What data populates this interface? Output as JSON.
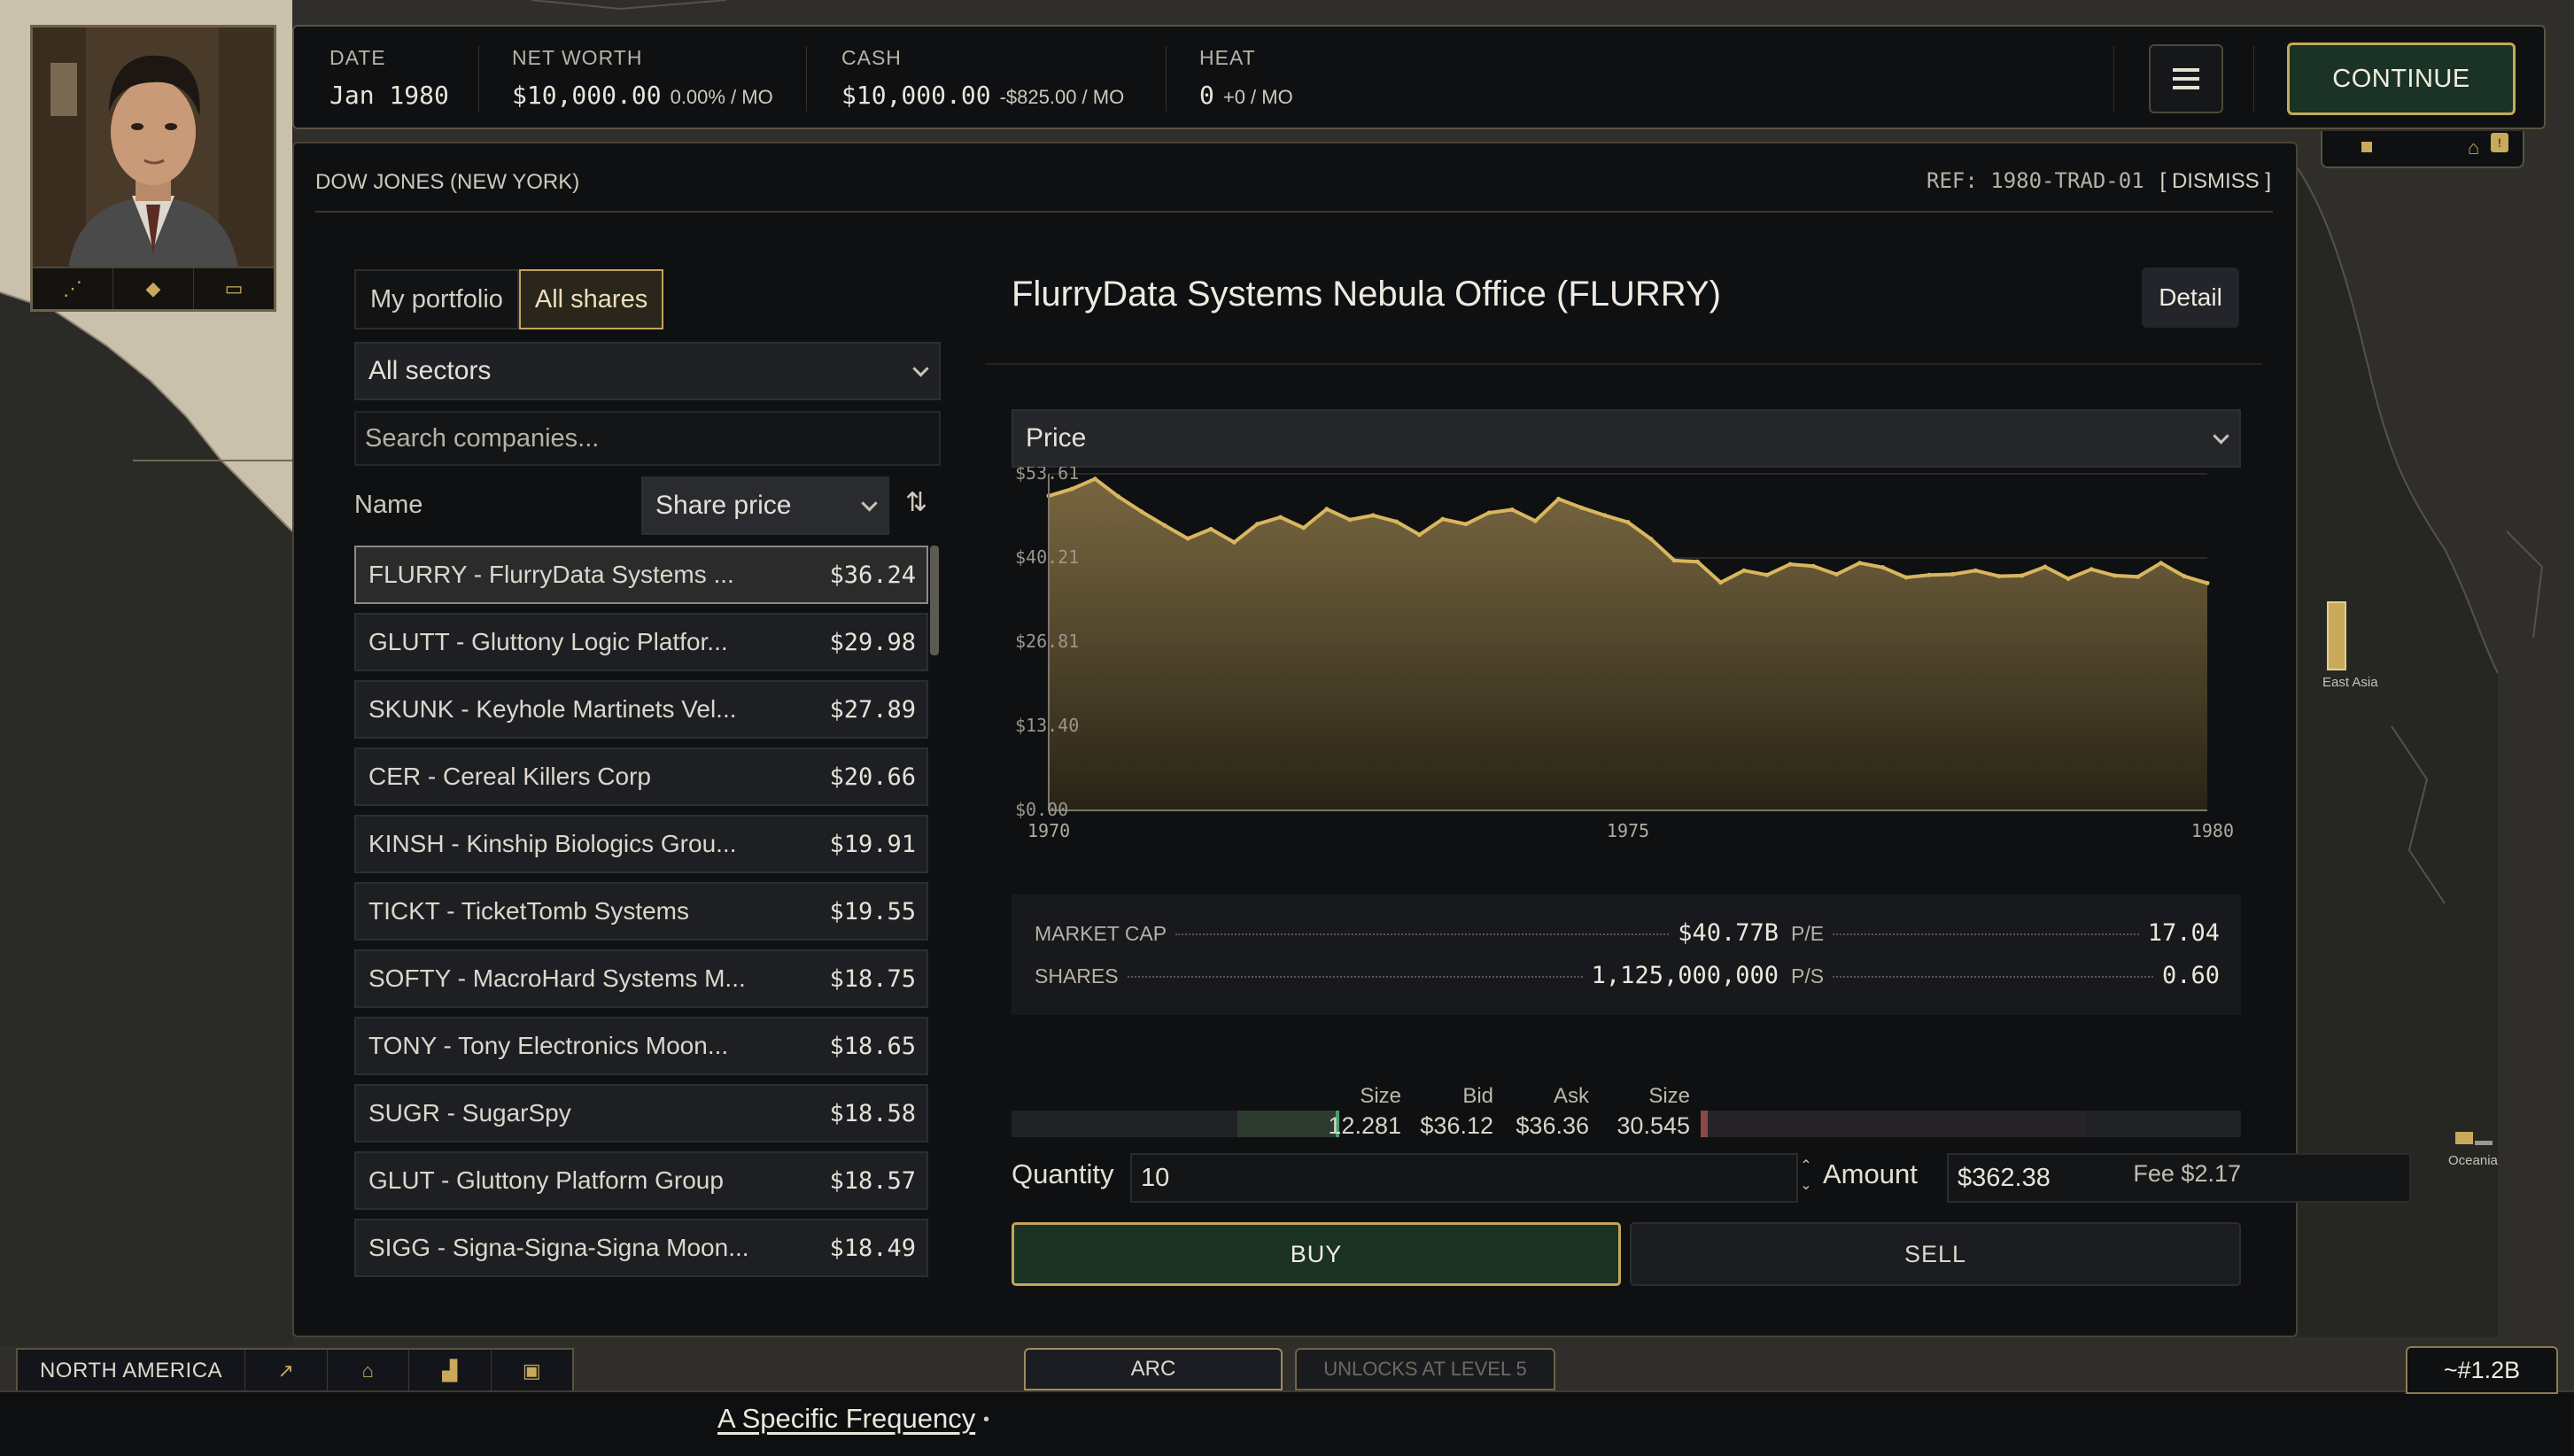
{
  "header": {
    "date": {
      "label": "DATE",
      "value": "Jan 1980"
    },
    "net_worth": {
      "label": "NET WORTH",
      "value": "$10,000.00",
      "change": "0.00% / MO"
    },
    "cash": {
      "label": "CASH",
      "value": "$10,000.00",
      "change": "-$825.00 / MO"
    },
    "heat": {
      "label": "HEAT",
      "value": "0",
      "change": "+0 / MO"
    },
    "continue_label": "CONTINUE",
    "notification_badge": "!"
  },
  "panel": {
    "title": "DOW JONES (NEW YORK)",
    "ref": "REF: 1980-TRAD-01",
    "dismiss_label": "[ DISMISS ]"
  },
  "left": {
    "tabs": [
      {
        "label": "My portfolio",
        "active": false
      },
      {
        "label": "All shares",
        "active": true
      }
    ],
    "sector_filter": "All sectors",
    "search_placeholder": "Search companies...",
    "name_header": "Name",
    "sort_by": "Share price",
    "stocks": [
      {
        "label": "FLURRY - FlurryData Systems ...",
        "price": "$36.24",
        "selected": true
      },
      {
        "label": "GLUTT - Gluttony Logic Platfor...",
        "price": "$29.98"
      },
      {
        "label": "SKUNK - Keyhole Martinets Vel...",
        "price": "$27.89"
      },
      {
        "label": "CER - Cereal Killers Corp",
        "price": "$20.66"
      },
      {
        "label": "KINSH - Kinship Biologics Grou...",
        "price": "$19.91"
      },
      {
        "label": "TICKT - TicketTomb Systems",
        "price": "$19.55"
      },
      {
        "label": "SOFTY - MacroHard Systems M...",
        "price": "$18.75"
      },
      {
        "label": "TONY - Tony Electronics Moon...",
        "price": "$18.65"
      },
      {
        "label": "SUGR - SugarSpy",
        "price": "$18.58"
      },
      {
        "label": "GLUT - Gluttony Platform Group",
        "price": "$18.57"
      },
      {
        "label": "SIGG - Signa-Signa-Signa Moon...",
        "price": "$18.49"
      }
    ]
  },
  "company": {
    "title": "FlurryData Systems Nebula Office (FLURRY)",
    "detail_label": "Detail",
    "metric": "Price",
    "market_cap": {
      "label": "MARKET CAP",
      "value": "$40.77B"
    },
    "pe": {
      "label": "P/E",
      "value": "17.04"
    },
    "shares": {
      "label": "SHARES",
      "value": "1,125,000,000"
    },
    "ps": {
      "label": "P/S",
      "value": "0.60"
    }
  },
  "chart_data": {
    "type": "area",
    "title": "",
    "xlabel": "",
    "ylabel": "",
    "x_ticks": [
      "1970",
      "1975",
      "1980"
    ],
    "y_ticks": [
      "$53.61",
      "$40.21",
      "$26.81",
      "$13.40",
      "$0.00"
    ],
    "xlim": [
      1970,
      1980
    ],
    "ylim": [
      0,
      53.61
    ],
    "grid": true,
    "color": "#d9b65e",
    "x": [
      1970.0,
      1970.2,
      1970.4,
      1970.6,
      1970.8,
      1971.0,
      1971.2,
      1971.4,
      1971.6,
      1971.8,
      1972.0,
      1972.2,
      1972.4,
      1972.6,
      1972.8,
      1973.0,
      1973.2,
      1973.4,
      1973.6,
      1973.8,
      1974.0,
      1974.2,
      1974.4,
      1974.6,
      1974.8,
      1975.0,
      1975.2,
      1975.4,
      1975.6,
      1975.8,
      1976.0,
      1976.2,
      1976.4,
      1976.6,
      1976.8,
      1977.0,
      1977.2,
      1977.4,
      1977.6,
      1977.8,
      1978.0,
      1978.2,
      1978.4,
      1978.6,
      1978.8,
      1979.0,
      1979.2,
      1979.4,
      1979.6,
      1979.8,
      1980.0
    ],
    "y": [
      50.1,
      51.2,
      52.8,
      50.0,
      47.6,
      45.4,
      43.3,
      44.8,
      42.7,
      45.6,
      46.7,
      45.0,
      48.0,
      46.3,
      47.0,
      46.0,
      43.9,
      46.4,
      45.6,
      47.4,
      47.9,
      46.1,
      49.6,
      48.2,
      47.0,
      45.9,
      43.2,
      39.8,
      39.6,
      36.3,
      38.2,
      37.5,
      39.2,
      38.9,
      37.6,
      39.4,
      38.7,
      37.1,
      37.5,
      37.6,
      38.2,
      37.3,
      37.4,
      38.8,
      36.9,
      38.4,
      37.4,
      37.2,
      39.4,
      37.3,
      36.2
    ]
  },
  "order_book": {
    "size_label": "Size",
    "bid_label": "Bid",
    "ask_label": "Ask",
    "bid_size": "12.281",
    "bid": "$36.12",
    "ask": "$36.36",
    "ask_size": "30.545",
    "bid_depth_fraction": 0.3,
    "ask_depth_fraction": 0.7
  },
  "trade": {
    "quantity_label": "Quantity",
    "quantity": "10",
    "amount_label": "Amount",
    "amount": "$362.38",
    "fee": "Fee $2.17",
    "buy_label": "BUY",
    "sell_label": "SELL"
  },
  "bottom": {
    "region": "NORTH AMERICA",
    "arc_label": "ARC",
    "unlock_label": "UNLOCKS AT LEVEL 5",
    "track": "A Specific Frequency",
    "track_dot": "•",
    "net": "~#1.2B"
  },
  "map": {
    "labels": [
      "East Asia",
      "Oceania"
    ]
  },
  "icons": {
    "portrait_actions": [
      "network-icon",
      "gem-icon",
      "briefcase-icon"
    ],
    "region_actions": [
      "chart-icon",
      "bank-icon",
      "factory-icon",
      "box-icon"
    ]
  }
}
